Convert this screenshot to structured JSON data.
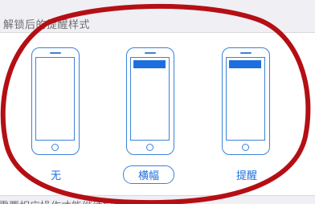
{
  "section_header": "解锁后的提醒样式",
  "options": [
    {
      "label": "无",
      "has_banner": false,
      "selected": false
    },
    {
      "label": "横幅",
      "has_banner": true,
      "selected": true
    },
    {
      "label": "提醒",
      "has_banner": true,
      "selected": false
    }
  ],
  "footer_note": "需要相应操作才能继续提醒。",
  "colors": {
    "accent": "#1d6fe0",
    "outline": "#3b82d8",
    "annotation_circle": "#b40f14",
    "background": "#efeff4"
  }
}
